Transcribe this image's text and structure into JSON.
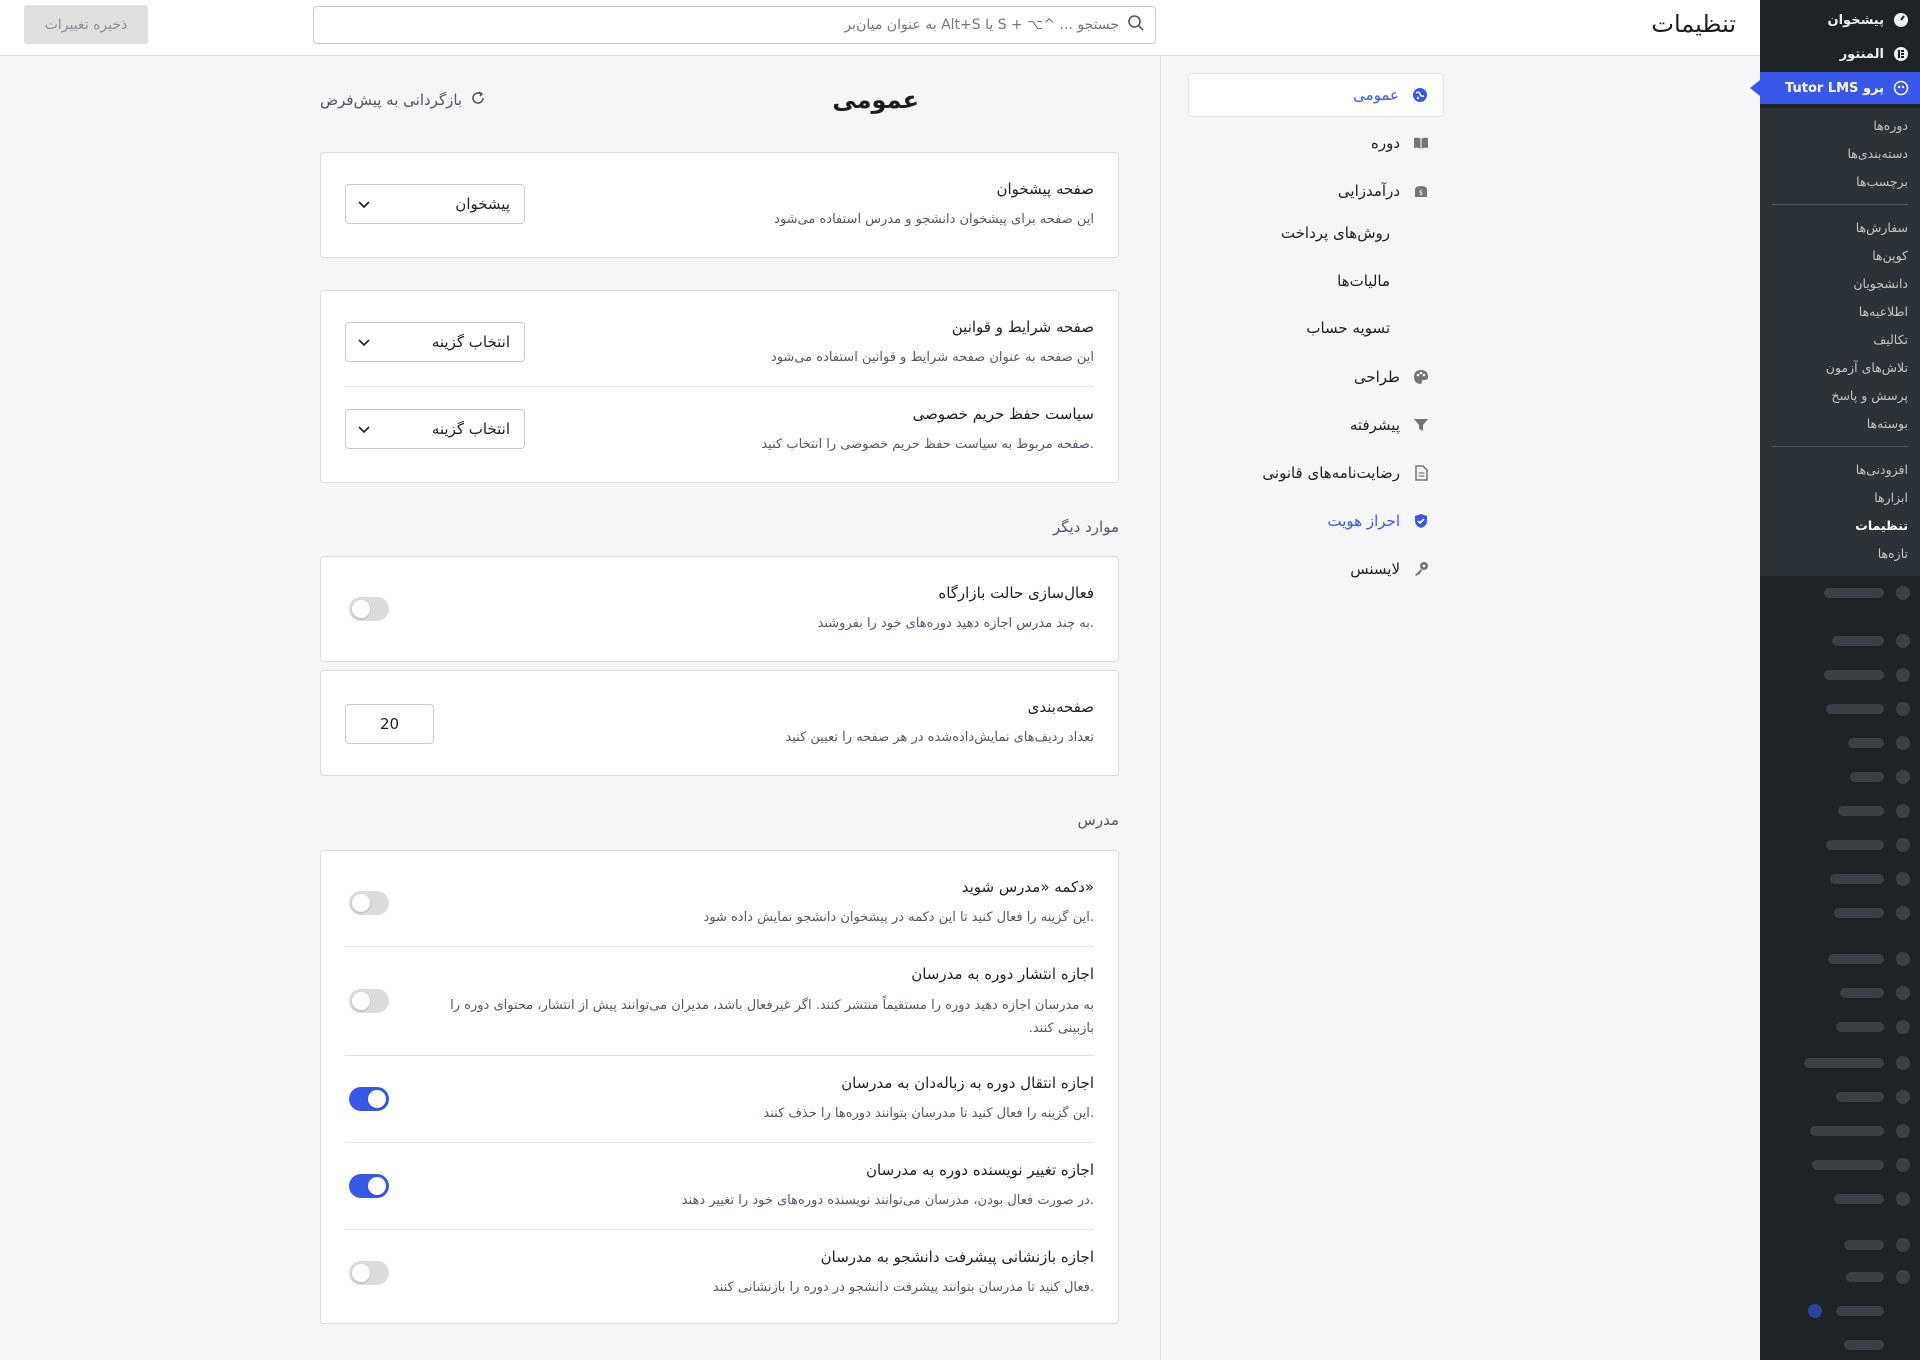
{
  "wp_sidebar": {
    "top_items": [
      {
        "label": "پیشخوان",
        "icon": "dashboard-icon"
      },
      {
        "label": "المنتور",
        "icon": "elementor-icon"
      },
      {
        "label": "Tutor LMS پرو",
        "icon": "tutor-icon"
      }
    ],
    "submenu": [
      "دوره‌ها",
      "دسته‌بندی‌ها",
      "برچسب‌ها",
      "سفارش‌ها",
      "کوپن‌ها",
      "دانشجویان",
      "اطلاعیه‌ها",
      "تکالیف",
      "تلاش‌های آزمون",
      "پرسش و پاسخ",
      "بوسته‌ها",
      "افزودنی‌ها",
      "ابزارها",
      "تنظیمات",
      "تازه‌ها"
    ],
    "current_submenu": "تنظیمات"
  },
  "header": {
    "title": "تنظیمات",
    "search_placeholder": "جستجو ... ^⌥ + S یا Alt+S به عنوان میان‌بر",
    "save_label": "ذخیره تغییرات"
  },
  "nav": {
    "items": [
      {
        "label": "عمومی",
        "icon": "globe-icon",
        "active": true
      },
      {
        "label": "دوره",
        "icon": "book-icon"
      },
      {
        "label": "درآمدزایی",
        "icon": "monetization-icon"
      },
      {
        "label": "طراحی",
        "icon": "palette-icon"
      },
      {
        "label": "پیشرفته",
        "icon": "filter-icon"
      },
      {
        "label": "رضایت‌نامه‌های قانونی",
        "icon": "document-icon"
      },
      {
        "label": "احراز هویت",
        "icon": "shield-icon"
      },
      {
        "label": "لایسنس",
        "icon": "key-icon"
      }
    ],
    "monetization_sub": [
      "روش‌های پرداخت",
      "مالیات‌ها",
      "تسویه حساب"
    ]
  },
  "content": {
    "section_title": "عمومی",
    "reset_label": "بازگردانی به پیش‌فرض",
    "dashboard_page": {
      "title": "صفحه پیشخوان",
      "desc": "این صفحه برای پیشخوان دانشجو و مدرس استفاده می‌شود",
      "value": "پیشخوان"
    },
    "terms_page": {
      "title": "صفحه شرایط و قوانین",
      "desc": "این صفحه به عنوان صفحه شرایط و قوانین استفاده می‌شود",
      "value": "انتخاب گزینه"
    },
    "privacy_page": {
      "title": "سیاست حفظ حریم خصوصی",
      "desc": "صفحه مربوط به سیاست حفظ حریم خصوصی را انتخاب کنید.",
      "value": "انتخاب گزینه"
    },
    "other_label": "موارد دیگر",
    "marketplace": {
      "title": "فعال‌سازی حالت بازارگاه",
      "desc": "به چند مدرس اجازه دهید دوره‌های خود را بفروشند.",
      "enabled": false
    },
    "pagination": {
      "title": "صفحه‌بندی",
      "desc": "تعداد ردیف‌های نمایش‌داده‌شده در هر صفحه را تعیین کنید",
      "value": "20"
    },
    "instructor_label": "مدرس",
    "instructor_rows": [
      {
        "title": "دکمه «مدرس شوید»",
        "desc": "این گزینه را فعال کنید تا این دکمه در پیشخوان دانشجو نمایش داده شود.",
        "enabled": false
      },
      {
        "title": "اجازه انتشار دوره به مدرسان",
        "desc": "به مدرسان اجازه دهید دوره را مستقیماً منتشر کنند. اگر غیرفعال باشد، مدیران می‌توانند پیش از انتشار، محتوای دوره را بازبینی کنند.",
        "enabled": false
      },
      {
        "title": "اجازه انتقال دوره به زباله‌دان به مدرسان",
        "desc": "این گزینه را فعال کنید تا مدرسان بتوانند دوره‌ها را حذف کنند.",
        "enabled": true
      },
      {
        "title": "اجازه تغییر نویسنده دوره به مدرسان",
        "desc": "در صورت فعال بودن، مدرسان می‌توانند نویسنده دوره‌های خود را تغییر دهند.",
        "enabled": true
      },
      {
        "title": "اجازه بازنشانی پیشرفت دانشجو به مدرسان",
        "desc": "فعال کنید تا مدرسان بتوانند پیشرفت دانشجو در دوره را بازنشانی کنند.",
        "enabled": false
      }
    ]
  },
  "colors": {
    "accent": "#3858e9",
    "wp_sidebar": "#1d2327",
    "wp_submenu": "#2c3338"
  }
}
